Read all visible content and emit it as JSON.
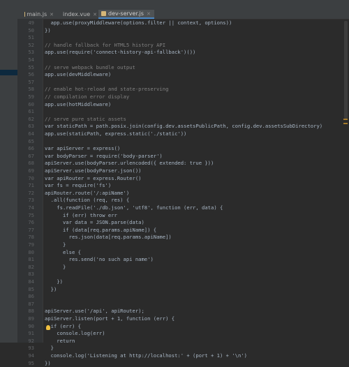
{
  "tabs": [
    {
      "label": "main.js",
      "icon": "js-file-icon",
      "color": "#d5b778",
      "active": false
    },
    {
      "label": "index.vue",
      "icon": "vue-file-icon",
      "color": "#42b883",
      "active": false
    },
    {
      "label": "dev-server.js",
      "icon": "js-file-icon",
      "color": "#d5b778",
      "active": true
    }
  ],
  "editor": {
    "lines": [
      {
        "n": "49",
        "t": "  app.use(proxyMiddleware(options.filter || context, options))"
      },
      {
        "n": "50",
        "t": "})"
      },
      {
        "n": "51",
        "t": ""
      },
      {
        "n": "52",
        "t": "// handle fallback for HTML5 history API"
      },
      {
        "n": "53",
        "t": "app.use(require('connect-history-api-fallback')())"
      },
      {
        "n": "54",
        "t": ""
      },
      {
        "n": "55",
        "t": "// serve webpack bundle output"
      },
      {
        "n": "56",
        "t": "app.use(devMiddleware)"
      },
      {
        "n": "57",
        "t": ""
      },
      {
        "n": "58",
        "t": "// enable hot-reload and state-preserving"
      },
      {
        "n": "59",
        "t": "// compilation error display"
      },
      {
        "n": "60",
        "t": "app.use(hotMiddleware)"
      },
      {
        "n": "61",
        "t": ""
      },
      {
        "n": "62",
        "t": "// serve pure static assets"
      },
      {
        "n": "63",
        "t": "var staticPath = path.posix.join(config.dev.assetsPublicPath, config.dev.assetsSubDirectory)"
      },
      {
        "n": "64",
        "t": "app.use(staticPath, express.static('./static'))"
      },
      {
        "n": "65",
        "t": ""
      },
      {
        "n": "66",
        "t": "var apiServer = express()"
      },
      {
        "n": "67",
        "t": "var bodyParser = require('body-parser')"
      },
      {
        "n": "68",
        "t": "apiServer.use(bodyParser.urlencoded({ extended: true }))"
      },
      {
        "n": "69",
        "t": "apiServer.use(bodyParser.json())"
      },
      {
        "n": "70",
        "t": "var apiRouter = express.Router()"
      },
      {
        "n": "71",
        "t": "var fs = require('fs')"
      },
      {
        "n": "72",
        "t": "apiRouter.route('/:apiName')"
      },
      {
        "n": "73",
        "t": "  .all(function (req, res) {"
      },
      {
        "n": "74",
        "t": "    fs.readFile('./db.json', 'utf8', function (err, data) {"
      },
      {
        "n": "75",
        "t": "      if (err) throw err"
      },
      {
        "n": "76",
        "t": "      var data = JSON.parse(data)"
      },
      {
        "n": "77",
        "t": "      if (data[req.params.apiName]) {"
      },
      {
        "n": "78",
        "t": "        res.json(data[req.params.apiName])"
      },
      {
        "n": "79",
        "t": "      }"
      },
      {
        "n": "80",
        "t": "      else {"
      },
      {
        "n": "81",
        "t": "        res.send('no such api name')"
      },
      {
        "n": "82",
        "t": "      }"
      },
      {
        "n": "83",
        "t": ""
      },
      {
        "n": "84",
        "t": "    })"
      },
      {
        "n": "85",
        "t": "  })"
      },
      {
        "n": "86",
        "t": ""
      },
      {
        "n": "87",
        "t": ""
      },
      {
        "n": "88",
        "t": "apiServer.use('/api', apiRouter);"
      },
      {
        "n": "89",
        "t": "apiServer.listen(port + 1, function (err) {"
      },
      {
        "n": "90",
        "t": "  if (err) {"
      },
      {
        "n": "91",
        "t": "    console.log(err)"
      },
      {
        "n": "92",
        "t": "    return"
      },
      {
        "n": "93",
        "t": "  }"
      },
      {
        "n": "94",
        "t": "  console.log('Listening at http://localhost:' + (port + 1) + '\\n')"
      },
      {
        "n": "95",
        "t": "})"
      }
    ]
  },
  "colors": {
    "background": "#2b2b2b",
    "text": "#a9b7c6",
    "keyword": "#cc7832",
    "string": "#6a8759",
    "comment": "#808080",
    "number": "#6897bb",
    "function": "#ffc66d",
    "highlight": "#9876aa"
  }
}
